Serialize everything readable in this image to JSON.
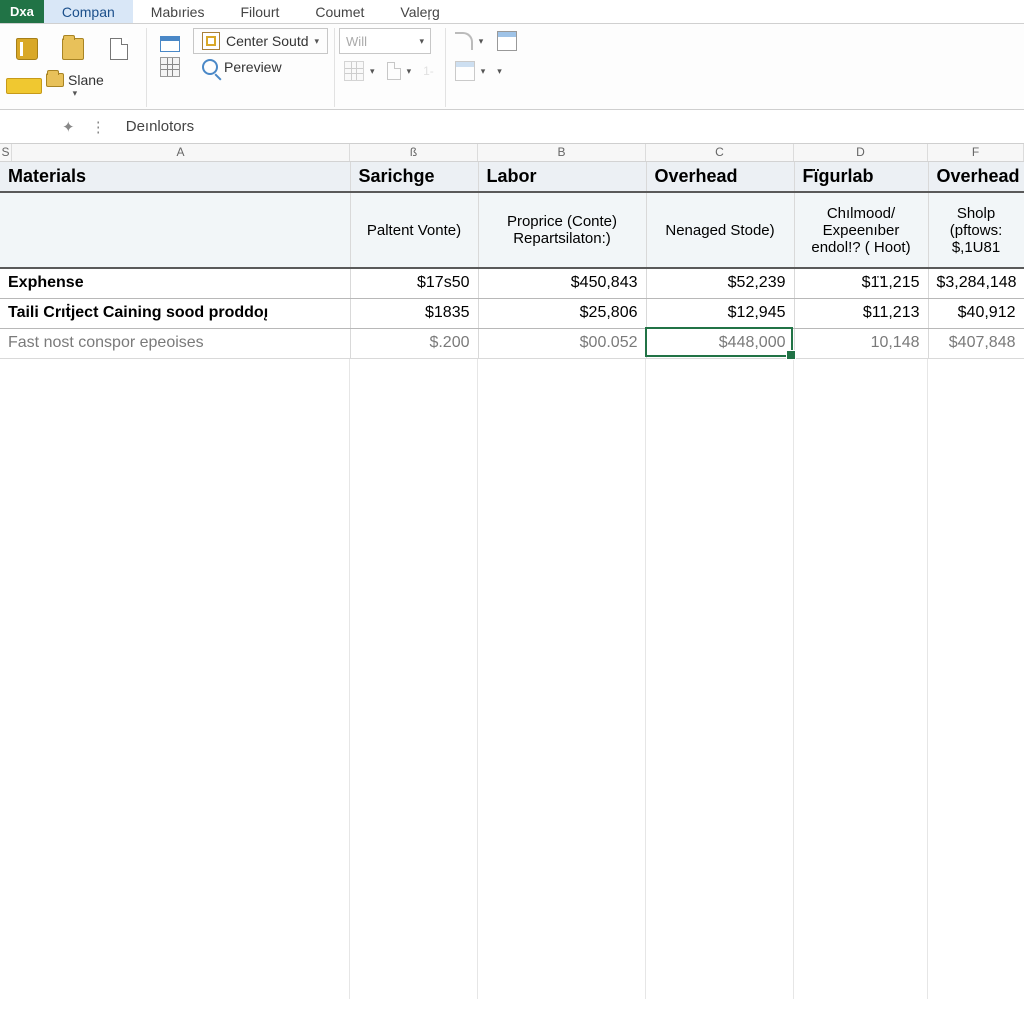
{
  "app_badge": "Dxa",
  "menu": {
    "items": [
      "Compan",
      "Mabıries",
      "Filourt",
      "Coumet",
      "Valeŗg"
    ],
    "active_index": 0
  },
  "ribbon": {
    "slane_label": "Slane",
    "center_soutd": "Center Soutd",
    "pereview": "Pereview",
    "font_dropdown_placeholder": "Will"
  },
  "formula_bar": {
    "text": "Deınlotors"
  },
  "col_letters": [
    "S",
    "A",
    "ß",
    "B",
    "C",
    "D",
    "F"
  ],
  "headers": [
    "Materials",
    "Sarichge",
    "Labor",
    "Overhead",
    "Fïgurlab",
    "Overhead"
  ],
  "subheaders": [
    "",
    "Paltent Vonte)",
    "Proprice (Conte) Repartsilaton:)",
    "Nenaged Stode)",
    "Chılmood/ Expeenıber endol!? ( Hoot)",
    "Sholp (pftows: $,1U81"
  ],
  "rows": [
    {
      "label": "Exphense",
      "cells": [
        "$17s50",
        "$450,843",
        "$52,239",
        "$1̈1,215",
        "$3,284,148"
      ],
      "bold": true
    },
    {
      "label": "Taili Crıṫject Caining sood proddoı̨",
      "cells": [
        "$1835",
        "$25,806",
        "$12,945",
        "$11,213",
        "$40,912"
      ],
      "bold": true
    },
    {
      "label": "Fast nost conspor epeoises",
      "cells": [
        "$.200",
        "$00.052",
        "$448,000",
        "10,148",
        "$407,848"
      ],
      "bold": false,
      "grey": true
    }
  ],
  "selected_cell": {
    "row_index": 2,
    "col_index": 3
  }
}
